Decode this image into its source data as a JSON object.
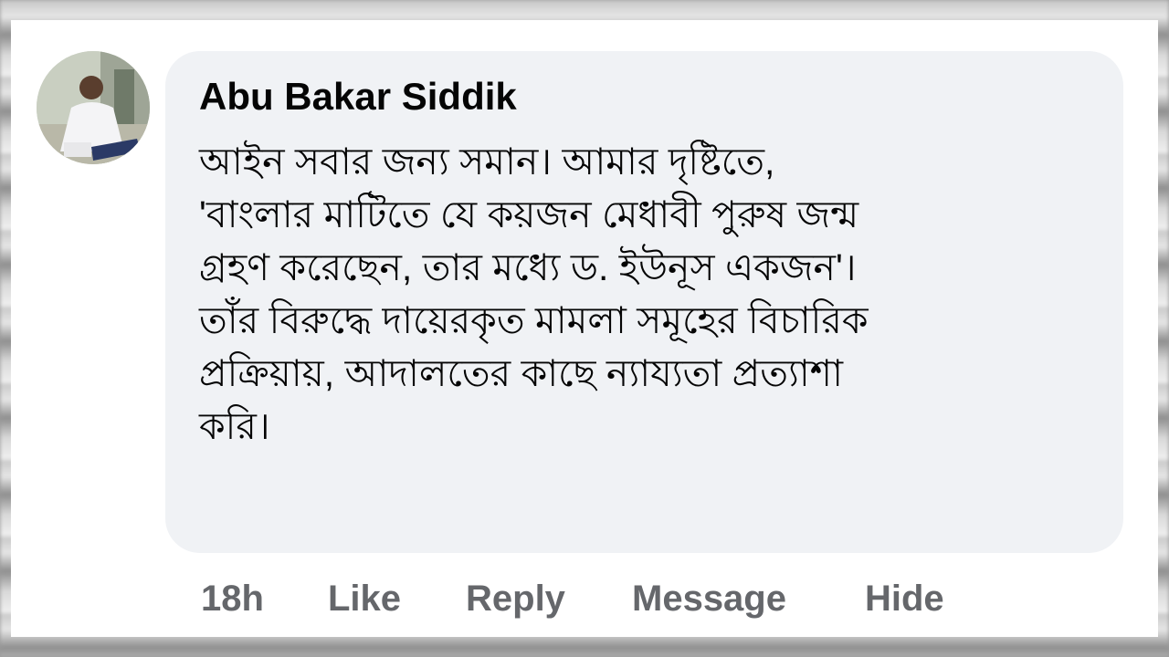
{
  "comment": {
    "author": "Abu Bakar Siddik",
    "lines": [
      "আইন সবার জন্য সমান। আমার দৃষ্টিতে,",
      "'বাংলার মাটিতে যে কয়জন মেধাবী পুরুষ জন্ম",
      "গ্রহণ করেছেন, তার মধ্যে ড. ইউনূস একজন'।",
      "তাঁর বিরুদ্ধে দায়েরকৃত মামলা সমূহের বিচারিক",
      "প্রক্রিয়ায়, আদালতের কাছে ন্যায্যতা প্রত্যাশা",
      "করি।"
    ]
  },
  "actions": {
    "time": "18h",
    "like": "Like",
    "reply": "Reply",
    "message": "Message",
    "hide": "Hide"
  },
  "colors": {
    "bubble": "#f0f2f5",
    "text": "#050505",
    "action_text": "#65676b"
  }
}
